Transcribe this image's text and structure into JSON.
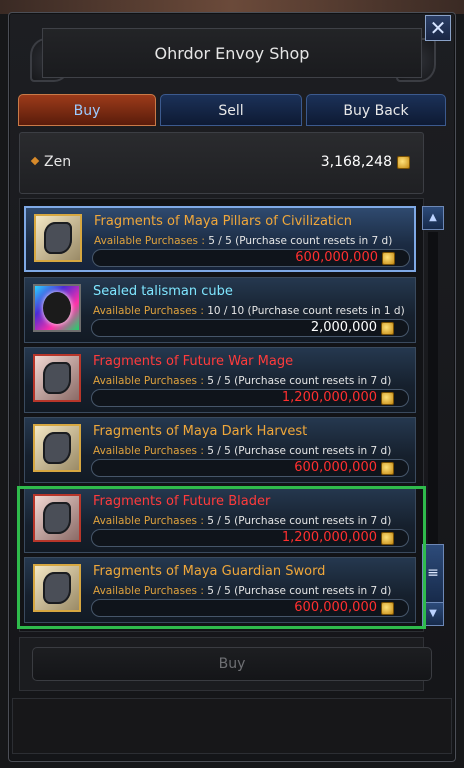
{
  "window": {
    "title": "Ohrdor Envoy Shop",
    "close_label": "✕"
  },
  "tabs": [
    {
      "label": "Buy",
      "active": true
    },
    {
      "label": "Sell",
      "active": false
    },
    {
      "label": "Buy Back",
      "active": false
    }
  ],
  "zen": {
    "label": "Zen",
    "value": "3,168,248"
  },
  "items": [
    {
      "name": "Fragments of Maya Pillars of Civilizaticn",
      "name_color": "orange",
      "avail_label": "Available Purchases : ",
      "avail_value": "5 / 5",
      "reset_text": "(Purchase count resets in 7 d)",
      "price": "600,000,000",
      "price_color": "red",
      "icon": "maya-fragment-icon",
      "frame": "gold",
      "selected": true
    },
    {
      "name": "Sealed talisman cube",
      "name_color": "cyan",
      "avail_label": "Available Purchases : ",
      "avail_value": "10 / 10",
      "reset_text": "(Purchase count resets in 1 d)",
      "price": "2,000,000",
      "price_color": "white",
      "icon": "talisman-cube-icon",
      "frame": "rainbow",
      "selected": false
    },
    {
      "name": "Fragments of Future War Mage",
      "name_color": "red",
      "avail_label": "Available Purchases : ",
      "avail_value": "5 / 5",
      "reset_text": "(Purchase count resets in 7 d)",
      "price": "1,200,000,000",
      "price_color": "red",
      "icon": "future-fragment-icon",
      "frame": "red",
      "selected": false
    },
    {
      "name": "Fragments of Maya Dark Harvest",
      "name_color": "orange",
      "avail_label": "Available Purchases : ",
      "avail_value": "5 / 5",
      "reset_text": "(Purchase count resets in 7 d)",
      "price": "600,000,000",
      "price_color": "red",
      "icon": "maya-fragment-icon",
      "frame": "gold",
      "selected": false
    },
    {
      "name": "Fragments of Future Blader",
      "name_color": "red",
      "avail_label": "Available Purchases : ",
      "avail_value": "5 / 5",
      "reset_text": "(Purchase count resets in 7 d)",
      "price": "1,200,000,000",
      "price_color": "red",
      "icon": "future-fragment-icon",
      "frame": "red",
      "selected": false
    },
    {
      "name": "Fragments of Maya Guardian Sword",
      "name_color": "orange",
      "avail_label": "Available Purchases : ",
      "avail_value": "5 / 5",
      "reset_text": "(Purchase count resets in 7 d)",
      "price": "600,000,000",
      "price_color": "red",
      "icon": "maya-fragment-icon",
      "frame": "gold",
      "selected": false
    }
  ],
  "scrollbar": {
    "up_glyph": "▲",
    "down_glyph": "▼",
    "thumb_glyph": "≡"
  },
  "buy_button_label": "Buy",
  "colors": {
    "highlight": "#2fbb4c",
    "price_red": "#ff2f2f",
    "name_orange": "#f0a73a",
    "name_red": "#ff3b3b",
    "name_cyan": "#7fe6ff"
  }
}
